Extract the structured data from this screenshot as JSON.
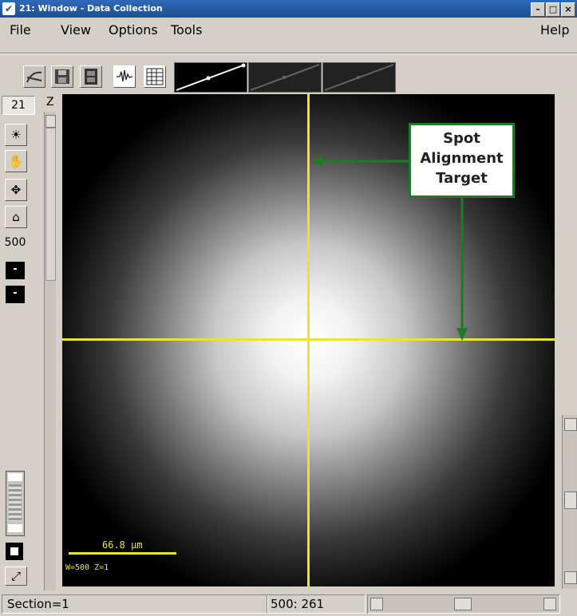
{
  "window": {
    "title": "21: Window - Data Collection",
    "minimize_label": "–",
    "maximize_label": "□",
    "close_label": "×"
  },
  "menubar": {
    "items": [
      {
        "label": "File"
      },
      {
        "label": "View"
      },
      {
        "label": "Options"
      },
      {
        "label": "Tools"
      },
      {
        "label": "Help"
      }
    ]
  },
  "left_panel": {
    "window_number": "21",
    "z_label": "Z",
    "zoom_value": "500",
    "minus_label_1": "-",
    "minus_label_2": "-"
  },
  "image": {
    "scale_bar_label": "66.8 μm",
    "info_label": "W=500 Z=1",
    "crosshair_color": "#e6e62e"
  },
  "callout": {
    "line1": "Spot",
    "line2": "Alignment",
    "line3": "Target",
    "color": "#1f7a27"
  },
  "statusbar": {
    "section": "Section=1",
    "coords": "500: 261"
  },
  "icons": [
    "menu-icon",
    "curve-icon",
    "save-icon",
    "film-icon",
    "waveform-icon",
    "table-icon",
    "sun-icon",
    "hand-icon",
    "move-icon",
    "home-icon"
  ]
}
